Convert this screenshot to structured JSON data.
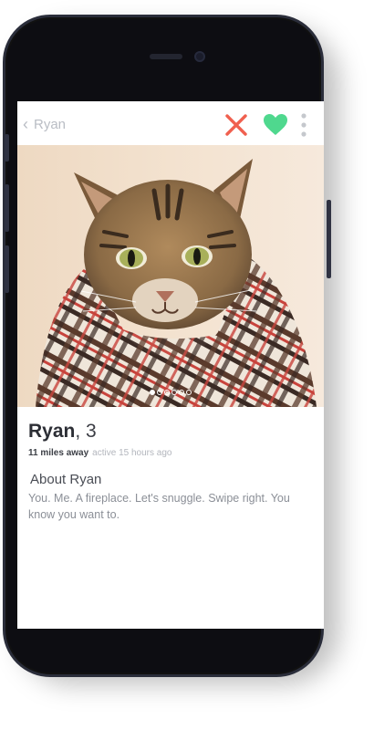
{
  "header": {
    "back_label": "Ryan"
  },
  "icons": {
    "back": "chevron-left-icon",
    "nope": "close-icon",
    "like": "heart-icon",
    "more": "more-vertical-icon"
  },
  "colors": {
    "nope": "#f0604f",
    "like": "#4fd88e",
    "more": "#c5c8cd"
  },
  "photo": {
    "subject": "tabby cat wrapped in plaid scarf",
    "dots": [
      {
        "active": true
      },
      {
        "active": false
      },
      {
        "active": false
      },
      {
        "active": false
      },
      {
        "active": false
      },
      {
        "active": false
      }
    ]
  },
  "profile": {
    "name": "Ryan",
    "age_text": ", 3",
    "distance": "11 miles away",
    "activity": "active 15 hours ago",
    "about_title": "About Ryan",
    "about_text": "You. Me. A fireplace. Let's snuggle. Swipe right. You know you want to."
  }
}
